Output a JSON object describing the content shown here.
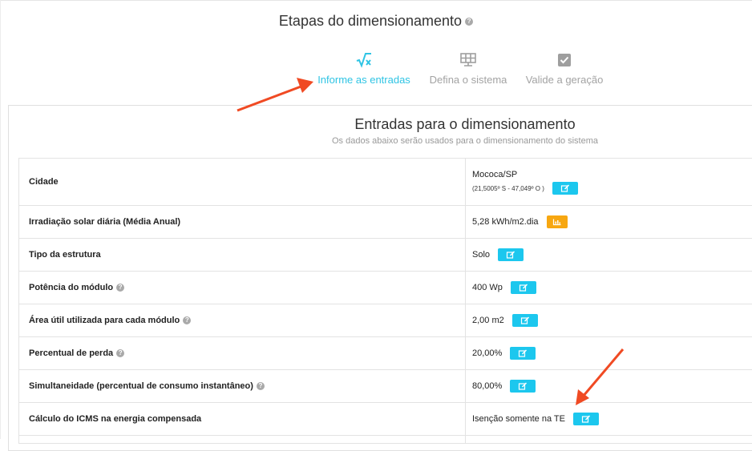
{
  "header": {
    "title": "Etapas do dimensionamento",
    "steps": [
      {
        "label": "Informe as entradas",
        "icon": "sqrt-x-icon",
        "active": true
      },
      {
        "label": "Defina o sistema",
        "icon": "solar-panel-icon",
        "active": false
      },
      {
        "label": "Valide a geração",
        "icon": "checkbox-icon",
        "active": false
      }
    ]
  },
  "panel": {
    "title": "Entradas para o dimensionamento",
    "subtitle": "Os dados abaixo serão usados para o dimensionamento do sistema"
  },
  "rows": [
    {
      "label": "Cidade",
      "value": "Mococa/SP",
      "extra": "(21,5005º S - 47,049º O )",
      "button": "edit-icon"
    },
    {
      "label": "Irradiação solar diária (Média Anual)",
      "value": "5,28 kWh/m2.dia",
      "button": "chart-icon"
    },
    {
      "label": "Tipo da estrutura",
      "value": "Solo",
      "button": "edit-icon"
    },
    {
      "label": "Potência do módulo",
      "value": "400 Wp",
      "button": "edit-icon",
      "help": true
    },
    {
      "label": "Área útil utilizada para cada módulo",
      "value": "2,00 m2",
      "button": "edit-icon",
      "help": true
    },
    {
      "label": "Percentual de perda",
      "value": "20,00%",
      "button": "edit-icon",
      "help": true
    },
    {
      "label": "Simultaneidade (percentual de consumo instantâneo)",
      "value": "80,00%",
      "button": "edit-icon",
      "help": true
    },
    {
      "label": "Cálculo do ICMS na energia compensada",
      "value": "Isenção somente na TE",
      "button": "edit-icon"
    }
  ],
  "colors": {
    "accent": "#1cc7ee",
    "orange": "#f7a711",
    "annotation": "#f04a23"
  }
}
